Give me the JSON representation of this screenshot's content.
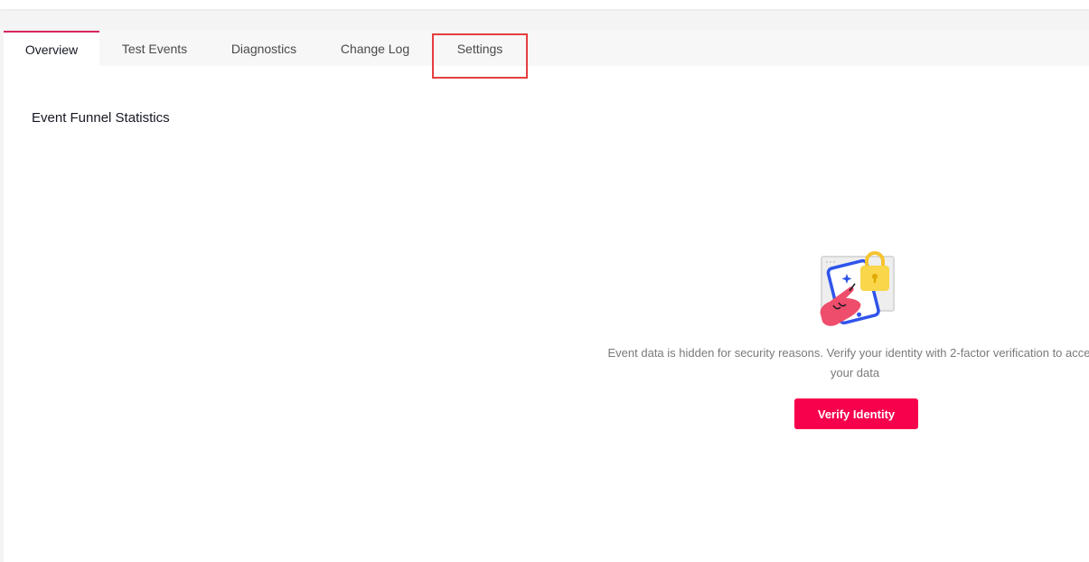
{
  "tabs": {
    "overview": "Overview",
    "test_events": "Test Events",
    "diagnostics": "Diagnostics",
    "change_log": "Change Log",
    "settings": "Settings",
    "active": "overview"
  },
  "section": {
    "title": "Event Funnel Statistics"
  },
  "security_notice": {
    "illustration_icon": "phone-lock-hand-icon",
    "line1": "Event data is hidden for security reasons. Verify your identity with 2-factor verification to access",
    "line2": "your data",
    "button_label": "Verify Identity"
  },
  "colors": {
    "accent": "#f7014d",
    "active_tab_border": "#d7265a",
    "highlight_box": "#e53e3e",
    "lock_yellow": "#f9d64a",
    "phone_blue": "#2f54eb",
    "hand_pink": "#ee4d6b"
  }
}
